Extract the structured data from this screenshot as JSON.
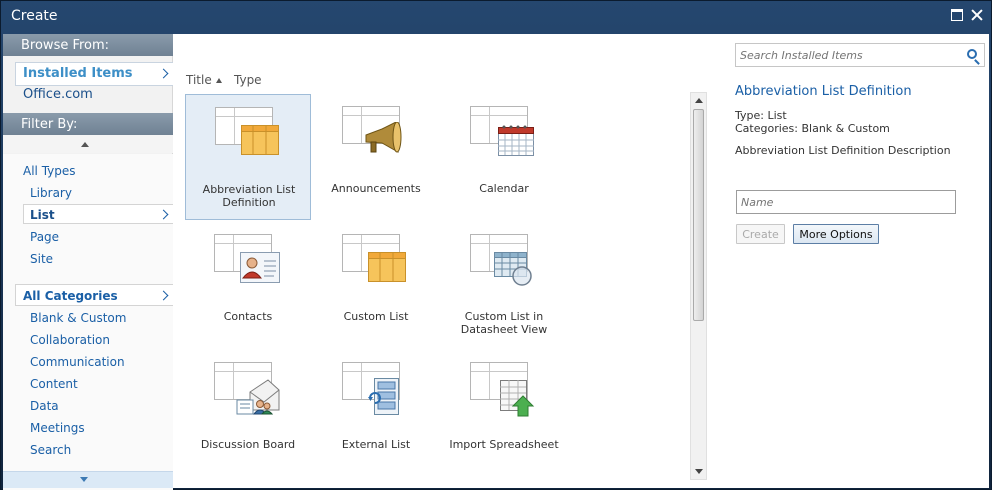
{
  "window": {
    "title": "Create"
  },
  "browse": {
    "heading": "Browse From:",
    "items": [
      {
        "label": "Installed Items",
        "selected": true
      },
      {
        "label": "Office.com",
        "selected": false
      }
    ]
  },
  "filter": {
    "heading": "Filter By:",
    "types": [
      {
        "label": "All Types",
        "selected": false
      },
      {
        "label": "Library",
        "selected": false
      },
      {
        "label": "List",
        "selected": true
      },
      {
        "label": "Page",
        "selected": false
      },
      {
        "label": "Site",
        "selected": false
      }
    ],
    "categories": [
      {
        "label": "All Categories",
        "selected": true
      },
      {
        "label": "Blank & Custom"
      },
      {
        "label": "Collaboration"
      },
      {
        "label": "Communication"
      },
      {
        "label": "Content"
      },
      {
        "label": "Data"
      },
      {
        "label": "Meetings"
      },
      {
        "label": "Search"
      }
    ]
  },
  "sort": {
    "title": "Title",
    "type": "Type"
  },
  "items": [
    {
      "label": "Abbreviation List Definition",
      "icon": "custom-list-icon",
      "selected": true
    },
    {
      "label": "Announcements",
      "icon": "megaphone-icon",
      "selected": false
    },
    {
      "label": "Calendar",
      "icon": "calendar-icon",
      "selected": false
    },
    {
      "label": "Contacts",
      "icon": "contact-card-icon",
      "selected": false
    },
    {
      "label": "Custom List",
      "icon": "custom-list-icon",
      "selected": false
    },
    {
      "label": "Custom List in Datasheet View",
      "icon": "datasheet-icon",
      "selected": false
    },
    {
      "label": "Discussion Board",
      "icon": "discussion-icon",
      "selected": false
    },
    {
      "label": "External List",
      "icon": "external-list-icon",
      "selected": false
    },
    {
      "label": "Import Spreadsheet",
      "icon": "import-spreadsheet-icon",
      "selected": false
    }
  ],
  "search": {
    "placeholder": "Search Installed Items"
  },
  "details": {
    "title": "Abbreviation List Definition",
    "type": "Type: List",
    "categories": "Categories: Blank & Custom",
    "description": "Abbreviation List Definition Description",
    "name_placeholder": "Name",
    "create_label": "Create",
    "more_options_label": "More Options"
  },
  "colors": {
    "accent": "#1a5fa6",
    "header": "#6f8193",
    "selected_bg": "#e4edf6",
    "orange": "#f5b942"
  }
}
